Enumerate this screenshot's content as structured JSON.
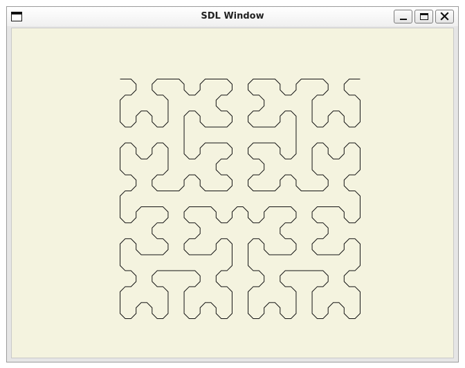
{
  "window": {
    "title": "SDL Window",
    "controls": [
      "minimize-icon",
      "maximize-icon",
      "close-icon"
    ]
  },
  "canvas": {
    "background": "#f4f3df",
    "stroke": "#111111",
    "figure": {
      "type": "hilbert-curve-rounded",
      "order": 4
    }
  },
  "colors": {
    "titlebar": "#f2f2f2",
    "frame": "#9a9a9a",
    "button_border": "#7b7b7b"
  }
}
